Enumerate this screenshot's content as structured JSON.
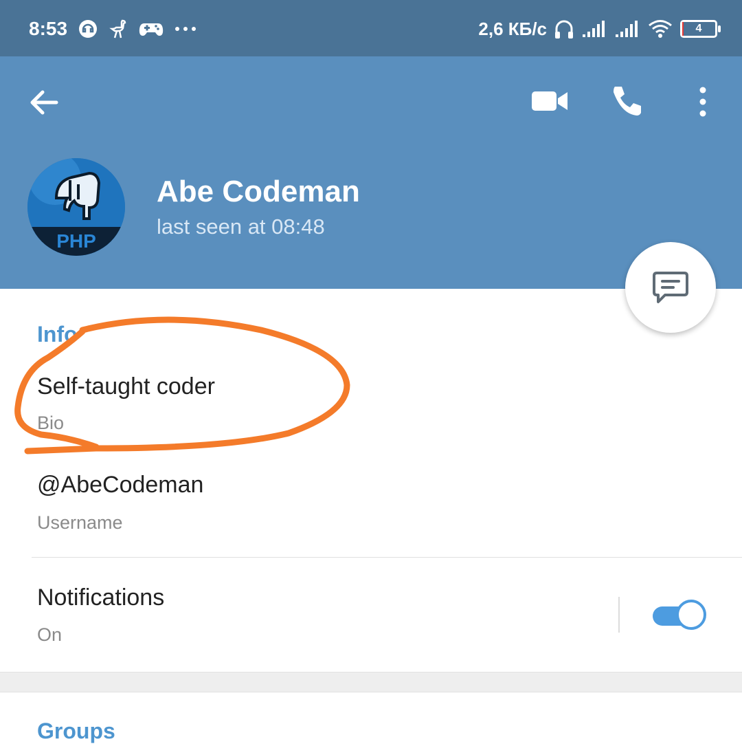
{
  "status_bar": {
    "time": "8:53",
    "speed": "2,6 КБ/с",
    "battery_level": "4",
    "left_icons": [
      "headset-app-icon",
      "ostrich-icon",
      "gamepad-icon",
      "more-notifications-icon"
    ],
    "right_icons": [
      "headphones-icon",
      "signal-icon",
      "signal-icon",
      "wifi-icon",
      "battery-icon"
    ]
  },
  "header": {
    "name": "Abe Codeman",
    "status": "last seen at 08:48",
    "avatar_text": "PHP",
    "background": "#5a8fbe",
    "actions": [
      "back-arrow-icon",
      "video-call-icon",
      "phone-icon",
      "more-vert-icon"
    ]
  },
  "info": {
    "section_title": "Info",
    "bio_value": "Self-taught coder",
    "bio_label": "Bio",
    "username_value": "@AbeCodeman",
    "username_label": "Username",
    "notifications_label": "Notifications",
    "notifications_state": "On",
    "notifications_enabled": true
  },
  "groups": {
    "section_title": "Groups"
  },
  "colors": {
    "accent": "#4d95cf",
    "status_bar": "#4a7396",
    "annotation": "#f47b2a"
  }
}
